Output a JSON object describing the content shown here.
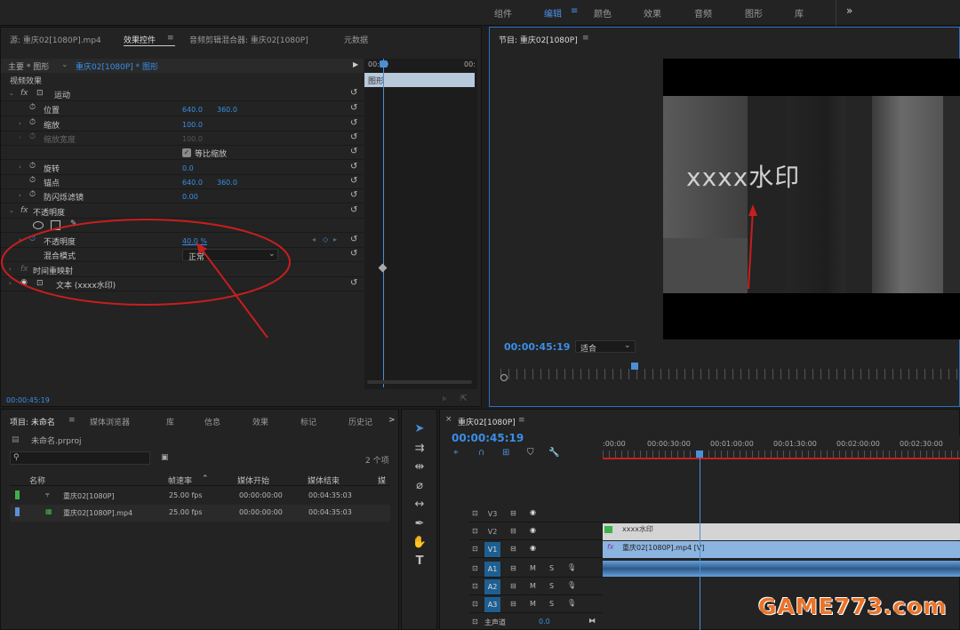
{
  "workspaces": [
    "组件",
    "编辑",
    "颜色",
    "效果",
    "音频",
    "图形",
    "库"
  ],
  "workspace_more": "»",
  "source_panel": {
    "tabs": [
      "源: 重庆02[1080P].mp4",
      "效果控件",
      "音频剪辑混合器: 重庆02[1080P]",
      "元数据"
    ],
    "menu_icon": "≡",
    "master_label": "主要 * 图形",
    "clip_label": "重庆02[1080P] * 图形",
    "ruler": {
      "start": "00:00",
      "end": "00:"
    },
    "clip_bar_label": "图形",
    "section_title": "视频效果",
    "rows": [
      {
        "label": "运动",
        "kind": "fx-section"
      },
      {
        "label": "位置",
        "v1": "640.0",
        "v2": "360.0"
      },
      {
        "label": "缩放",
        "v1": "100.0"
      },
      {
        "label": "缩放宽度",
        "v1": "100.0",
        "dim": true
      },
      {
        "label": "等比缩放",
        "kind": "checkbox"
      },
      {
        "label": "旋转",
        "v1": "0.0"
      },
      {
        "label": "锚点",
        "v1": "640.0",
        "v2": "360.0"
      },
      {
        "label": "防闪烁滤镜",
        "v1": "0.00"
      },
      {
        "label": "不透明度",
        "kind": "fx-section"
      },
      {
        "label": "不透明度",
        "v1": "40.0 %"
      },
      {
        "label": "混合模式",
        "select": "正常"
      },
      {
        "label": "时间重映射"
      },
      {
        "label": "文本 (xxxx水印)"
      }
    ],
    "fx_label": "fx",
    "timecode": "00:00:45:19"
  },
  "program": {
    "title": "节目: 重庆02[1080P]",
    "watermark_text": "xxxx水印",
    "timecode": "00:00:45:19",
    "fit": "适合"
  },
  "project": {
    "tabs": [
      "项目: 未命名",
      "媒体浏览器",
      "库",
      "信息",
      "效果",
      "标记",
      "历史记"
    ],
    "more": ">",
    "file": "未命名.prproj",
    "count": "2 个项",
    "columns": [
      "名称",
      "帧速率",
      "媒体开始",
      "媒体结束",
      "媒"
    ],
    "items": [
      {
        "name": "重庆02[1080P]",
        "fps": "25.00 fps",
        "start": "00:00:00:00",
        "end": "00:04:35:03",
        "color": "#3fb04a"
      },
      {
        "name": "重庆02[1080P].mp4",
        "fps": "25.00 fps",
        "start": "00:00:00:00",
        "end": "00:04:35:03",
        "color": "#5b8fd6"
      }
    ]
  },
  "timeline": {
    "title": "重庆02[1080P]",
    "close": "×",
    "timecode": "00:00:45:19",
    "ruler": [
      ":00:00",
      "00:00:30:00",
      "00:01:00:00",
      "00:01:30:00",
      "00:02:00:00",
      "00:02:30:00"
    ],
    "tracks": [
      {
        "name": "V3",
        "type": "video"
      },
      {
        "name": "V2",
        "type": "video"
      },
      {
        "name": "V1",
        "type": "video",
        "active": true
      },
      {
        "name": "A1",
        "type": "audio",
        "active": true
      },
      {
        "name": "A2",
        "type": "audio",
        "active": true
      },
      {
        "name": "A3",
        "type": "audio",
        "active": true
      }
    ],
    "clip_v2": "xxxx水印",
    "clip_v1": "重庆02[1080P].mp4 [V]",
    "master": "主声道",
    "master_val": "0.0",
    "btn_m": "M",
    "btn_s": "S"
  },
  "logo": "GAME773.com",
  "colors": {
    "accent": "#3a8ee6",
    "annotation": "#c81e1e",
    "playhead": "#4a8fd8"
  }
}
